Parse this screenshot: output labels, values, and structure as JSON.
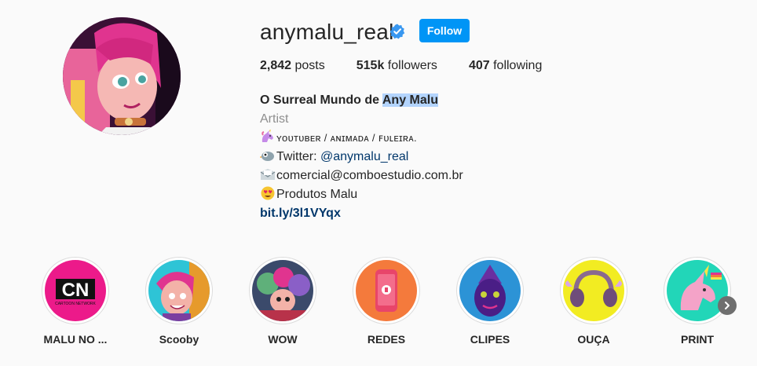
{
  "profile": {
    "username": "anymalu_real",
    "follow_label": "Follow",
    "verified_icon": "verified-badge-icon",
    "stats": {
      "posts_count": "2,842",
      "posts_label": "posts",
      "followers_count": "515k",
      "followers_label": "followers",
      "following_count": "407",
      "following_label": "following"
    },
    "bio": {
      "name_prefix": "O Surreal Mundo de ",
      "name_highlight": "Any Malu",
      "category": "Artist",
      "line1": "ʏᴏᴜᴛᴜʙᴇʀ / ᴀɴɪᴍᴀᴅᴀ / ꜰᴜʟᴇɪʀᴀ.",
      "line2_prefix": "Twitter: ",
      "line2_mention": "@anymalu_real",
      "line3": "comercial@comboestudio.com.br",
      "line4": "Produtos Malu",
      "link": "bit.ly/3l1VYqx"
    }
  },
  "highlights": [
    {
      "label": "MALU NO ...",
      "icon": "cartoon-network-logo"
    },
    {
      "label": "Scooby",
      "icon": "character-portrait"
    },
    {
      "label": "WOW",
      "icon": "group-art"
    },
    {
      "label": "REDES",
      "icon": "phone-icon"
    },
    {
      "label": "CLIPES",
      "icon": "character-face"
    },
    {
      "label": "OUÇA",
      "icon": "headphones-icon"
    },
    {
      "label": "PRINT",
      "icon": "unicorn-icon"
    }
  ],
  "colors": {
    "follow_button": "#0095f6",
    "verified": "#3897f0",
    "link": "#00376b",
    "text_highlight": "#b3d4fd"
  }
}
